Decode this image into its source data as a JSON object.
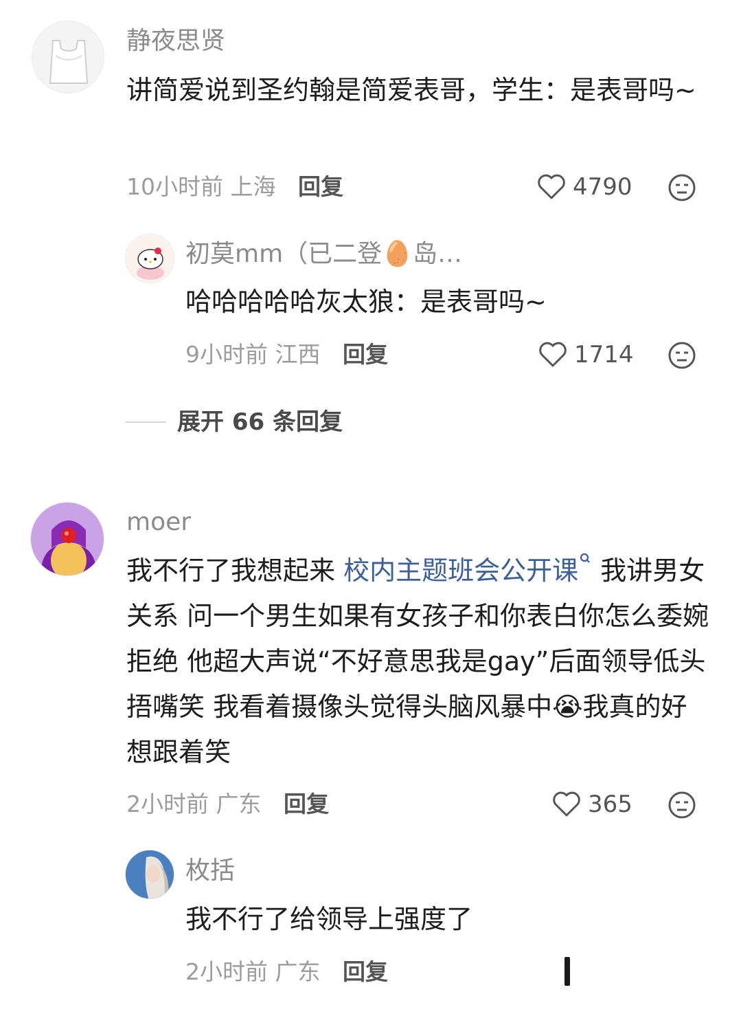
{
  "comments": [
    {
      "user": "静夜思贤",
      "text": "讲简爱说到圣约翰是简爱表哥，学生：是表哥吗~",
      "time": "10小时前",
      "location": "上海",
      "reply_label": "回复",
      "likes": "4790",
      "avatar_icon": "plastic-bag",
      "replies": [
        {
          "user": "初莫mm（已二登🥚岛…",
          "text": "哈哈哈哈哈灰太狼：是表哥吗~",
          "time": "9小时前",
          "location": "江西",
          "reply_label": "回复",
          "likes": "1714",
          "avatar_icon": "hello-kitty"
        }
      ],
      "expand_label": "展开 66 条回复"
    },
    {
      "user": "moer",
      "text_before": "我不行了我想起来",
      "topic": "校内主题班会公开课",
      "text_after": "我讲男女关系 问一个男生如果有女孩子和你表白你怎么委婉拒绝 他超大声说“不好意思我是gay”后面领导低头捂嘴笑 我看着摄像头觉得头脑风暴中",
      "emoji": "😭",
      "text_end": "我真的好想跟着笑",
      "time": "2小时前",
      "location": "广东",
      "reply_label": "回复",
      "likes": "365",
      "avatar_icon": "purple-bird",
      "replies": [
        {
          "user": "枚括",
          "text": "我不行了给领导上强度了",
          "time": "2小时前",
          "location": "广东",
          "reply_label": "回复",
          "avatar_icon": "girl-photo"
        }
      ]
    }
  ],
  "icons": {
    "like": "heart-outline-icon",
    "dislike": "meh-face-icon",
    "search": "search-icon"
  },
  "colors": {
    "topic_link": "#3b5f9a",
    "meta": "#9c9c9c",
    "name": "#8b8b8b"
  }
}
